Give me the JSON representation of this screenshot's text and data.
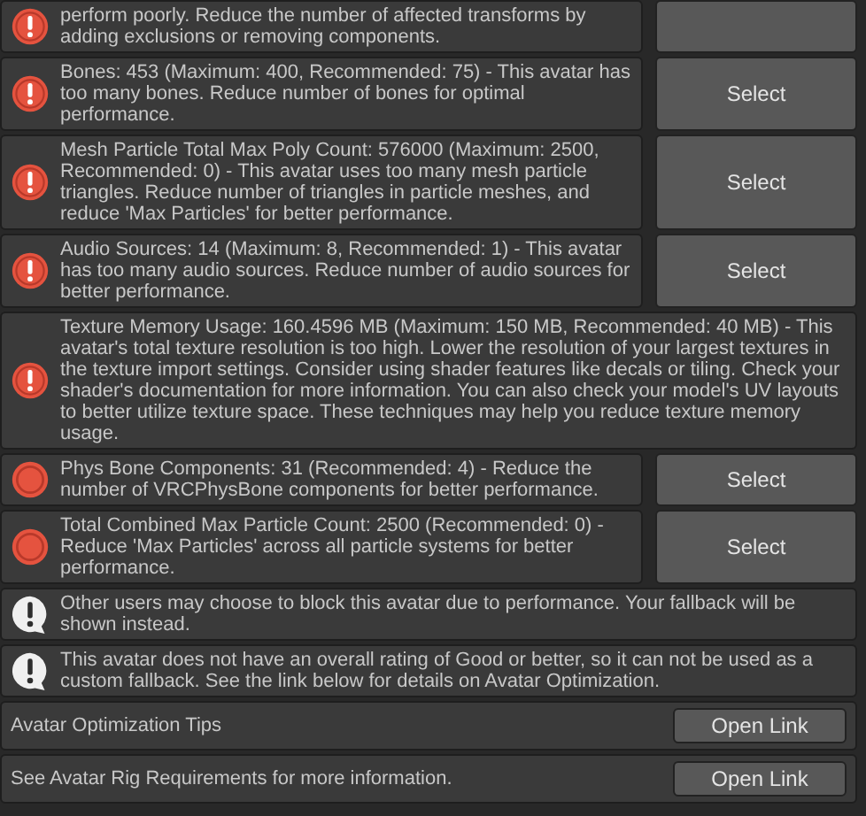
{
  "messages": [
    {
      "kind": "error",
      "text": "perform poorly. Reduce the number of affected transforms by\nadding exclusions or removing components.",
      "button": true
    },
    {
      "kind": "error",
      "text": "Bones: 453 (Maximum: 400, Recommended: 75) - This avatar has too many bones. Reduce number of bones for optimal performance.",
      "button": true,
      "button_label": "Select"
    },
    {
      "kind": "error",
      "text": "Mesh Particle Total Max Poly Count: 576000 (Maximum: 2500, Recommended: 0) - This avatar uses too many mesh particle triangles. Reduce number of triangles in particle meshes, and reduce 'Max Particles' for better performance.",
      "button": true,
      "button_label": "Select"
    },
    {
      "kind": "error",
      "text": "Audio Sources: 14 (Maximum: 8, Recommended: 1) - This avatar has too many audio sources. Reduce number of audio sources for better performance.",
      "button": true,
      "button_label": "Select"
    },
    {
      "kind": "error",
      "text": "Texture Memory Usage: 160.4596 MB (Maximum: 150 MB, Recommended: 40 MB) - This avatar's total texture resolution is too high. Lower the resolution of your largest textures in the texture import settings. Consider using shader features like decals or tiling. Check your shader's documentation for more information. You can also check your model's UV layouts to better utilize texture space. These techniques may help you reduce texture memory usage.",
      "button": false
    },
    {
      "kind": "warning",
      "text": "Phys Bone Components: 31 (Recommended: 4) - Reduce the number of VRCPhysBone components for better performance.",
      "button": true,
      "button_label": "Select"
    },
    {
      "kind": "warning",
      "text": "Total Combined Max Particle Count: 2500 (Recommended: 0) - Reduce 'Max Particles' across all particle systems for better performance.",
      "button": true,
      "button_label": "Select"
    },
    {
      "kind": "info",
      "text": "Other users may choose to block this avatar due to performance. Your fallback will be shown instead.",
      "button": false
    },
    {
      "kind": "info",
      "text": "This avatar does not have an overall rating of Good or better, so it can not be used as a custom fallback. See the link below for details on Avatar Optimization.",
      "button": false
    }
  ],
  "links": [
    {
      "text": "Avatar Optimization Tips",
      "button": "Open Link"
    },
    {
      "text": "See Avatar Rig Requirements for more information.",
      "button": "Open Link"
    }
  ]
}
